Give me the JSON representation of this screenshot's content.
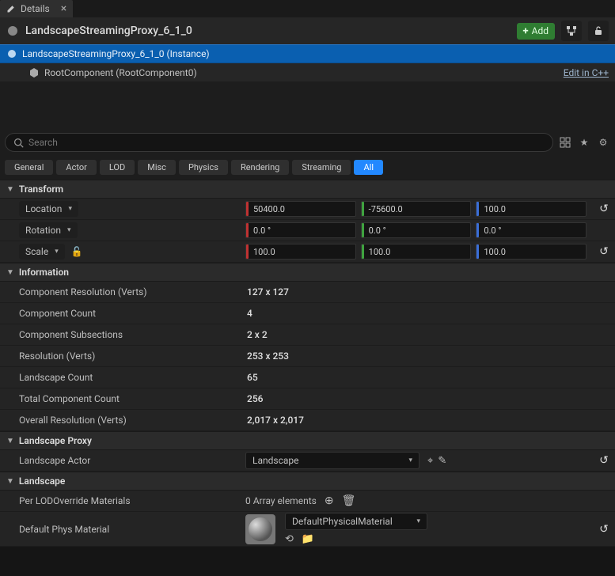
{
  "tab": {
    "title": "Details"
  },
  "object": {
    "name": "LandscapeStreamingProxy_6_1_0",
    "add_label": "Add"
  },
  "instance": {
    "label": "LandscapeStreamingProxy_6_1_0 (Instance)"
  },
  "component": {
    "label": "RootComponent (RootComponent0)",
    "edit_link": "Edit in C++"
  },
  "search": {
    "placeholder": "Search"
  },
  "chips": {
    "general": "General",
    "actor": "Actor",
    "lod": "LOD",
    "misc": "Misc",
    "physics": "Physics",
    "rendering": "Rendering",
    "streaming": "Streaming",
    "all": "All"
  },
  "sections": {
    "transform": "Transform",
    "information": "Information",
    "landscape_proxy": "Landscape Proxy",
    "landscape": "Landscape"
  },
  "transform": {
    "location_label": "Location",
    "rotation_label": "Rotation",
    "scale_label": "Scale",
    "location": {
      "x": "50400.0",
      "y": "-75600.0",
      "z": "100.0"
    },
    "rotation": {
      "x": "0.0 °",
      "y": "0.0 °",
      "z": "0.0 °"
    },
    "scale": {
      "x": "100.0",
      "y": "100.0",
      "z": "100.0"
    }
  },
  "info": {
    "comp_res_label": "Component Resolution (Verts)",
    "comp_res": "127 x 127",
    "comp_count_label": "Component Count",
    "comp_count": "4",
    "comp_sub_label": "Component Subsections",
    "comp_sub": "2 x 2",
    "res_label": "Resolution (Verts)",
    "res": "253 x 253",
    "land_count_label": "Landscape Count",
    "land_count": "65",
    "total_comp_label": "Total Component Count",
    "total_comp": "256",
    "overall_res_label": "Overall Resolution (Verts)",
    "overall_res": "2,017 x 2,017"
  },
  "proxy": {
    "actor_label": "Landscape Actor",
    "actor_value": "Landscape"
  },
  "landscape": {
    "per_lod_label": "Per LODOverride Materials",
    "per_lod_text": "0 Array elements",
    "default_phys_label": "Default Phys Material",
    "default_phys_value": "DefaultPhysicalMaterial"
  }
}
